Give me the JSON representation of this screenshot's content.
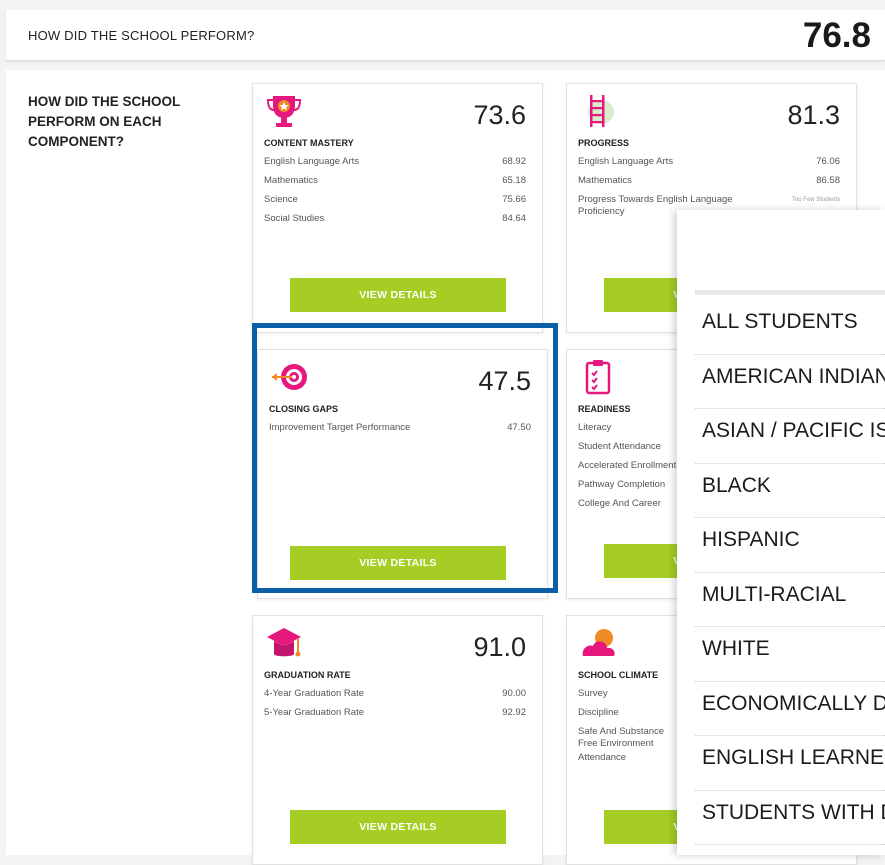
{
  "header": {
    "question": "HOW DID THE SCHOOL PERFORM?",
    "overall_score": "76.8"
  },
  "sidebar": {
    "question": "HOW DID THE SCHOOL PERFORM ON EACH COMPONENT?"
  },
  "cards": [
    {
      "id": "content-mastery",
      "title": "CONTENT MASTERY",
      "score": "73.6",
      "icon": "trophy-icon",
      "rows": [
        {
          "label": "English Language Arts",
          "value": "68.92"
        },
        {
          "label": "Mathematics",
          "value": "65.18"
        },
        {
          "label": "Science",
          "value": "75.66"
        },
        {
          "label": "Social Studies",
          "value": "84.64"
        }
      ],
      "button": "VIEW DETAILS"
    },
    {
      "id": "progress",
      "title": "PROGRESS",
      "score": "81.3",
      "icon": "ladder-icon",
      "rows": [
        {
          "label": "English Language Arts",
          "value": "76.06"
        },
        {
          "label": "Mathematics",
          "value": "86.58"
        },
        {
          "label": "Progress Towards English Language Proficiency",
          "value": "Too Few Students"
        }
      ],
      "button": "VIEW DETAILS"
    },
    {
      "id": "closing-gaps",
      "title": "CLOSING GAPS",
      "score": "47.5",
      "icon": "target-icon",
      "rows": [
        {
          "label": "Improvement Target Performance",
          "value": "47.50"
        }
      ],
      "button": "VIEW DETAILS"
    },
    {
      "id": "readiness",
      "title": "READINESS",
      "score": "",
      "icon": "clipboard-icon",
      "rows": [
        {
          "label": "Literacy",
          "value": ""
        },
        {
          "label": "Student Attendance",
          "value": ""
        },
        {
          "label": "Accelerated Enrollment",
          "value": ""
        },
        {
          "label": "Pathway Completion",
          "value": ""
        },
        {
          "label": "College And Career",
          "value": ""
        }
      ],
      "button": "VIEW DETAILS"
    },
    {
      "id": "graduation-rate",
      "title": "GRADUATION RATE",
      "score": "91.0",
      "icon": "graduation-cap-icon",
      "rows": [
        {
          "label": "4-Year Graduation Rate",
          "value": "90.00"
        },
        {
          "label": "5-Year Graduation Rate",
          "value": "92.92"
        }
      ],
      "button": "VIEW DETAILS"
    },
    {
      "id": "school-climate",
      "title": "SCHOOL CLIMATE",
      "score": "",
      "icon": "cloud-sun-icon",
      "rows": [
        {
          "label": "Survey",
          "value": ""
        },
        {
          "label": "Discipline",
          "value": ""
        },
        {
          "label": "Safe And Substance Free Environment",
          "value": ""
        },
        {
          "label": "Attendance",
          "value": ""
        }
      ],
      "button": "VIEW DETAILS"
    }
  ],
  "subgroups": {
    "items": [
      "ALL STUDENTS",
      "AMERICAN INDIAN",
      "ASIAN / PACIFIC ISLANDER",
      "BLACK",
      "HISPANIC",
      "MULTI-RACIAL",
      "WHITE",
      "ECONOMICALLY DISADVANTAGED",
      "ENGLISH LEARNERS",
      "STUDENTS WITH DISABILITIES"
    ]
  },
  "colors": {
    "accent_green": "#a5cd24",
    "brand_pink": "#e6187e",
    "highlight_blue": "#0a5fa8",
    "icon_orange": "#f08a24"
  }
}
